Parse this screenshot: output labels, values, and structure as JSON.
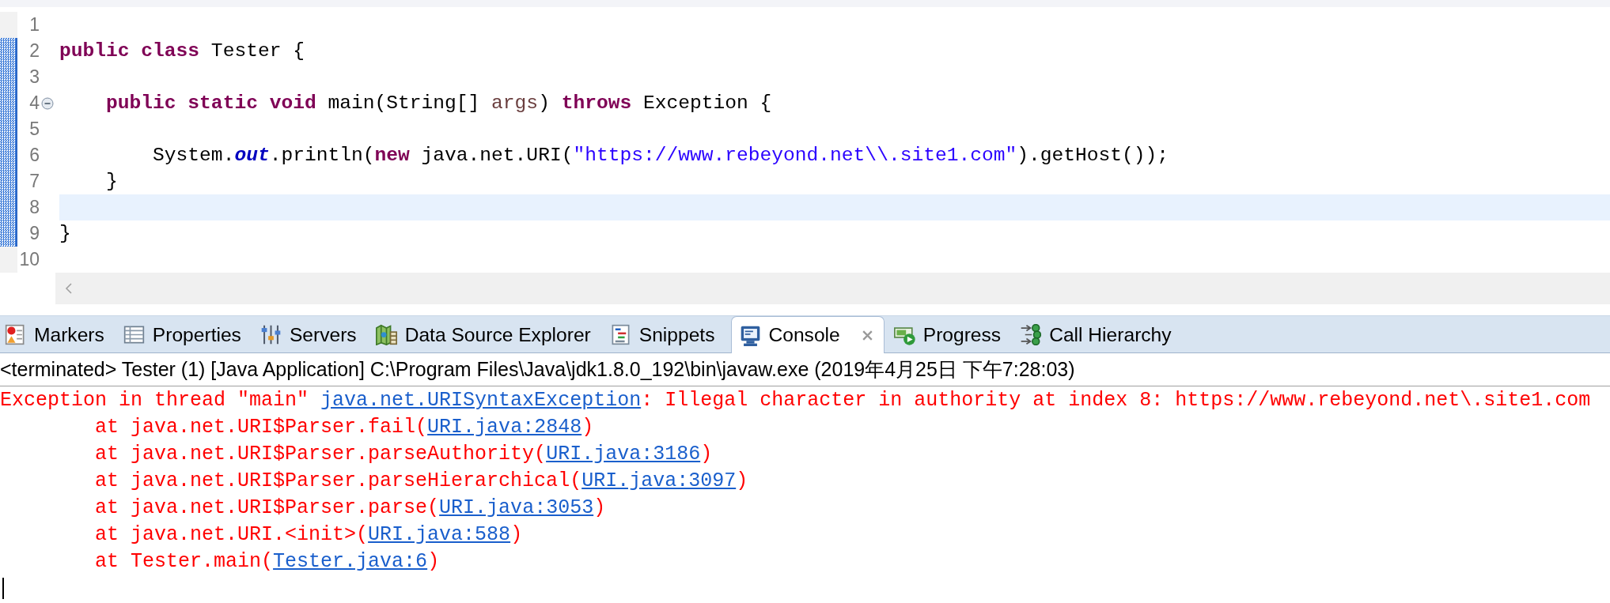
{
  "editor": {
    "lines": [
      {
        "number": "1",
        "changed": false,
        "current": false
      },
      {
        "number": "2",
        "changed": true,
        "current": false,
        "tokens": [
          {
            "text": "public class",
            "kind": "keyword"
          },
          {
            "text": " Tester {",
            "kind": "plain"
          }
        ]
      },
      {
        "number": "3",
        "changed": true,
        "current": false
      },
      {
        "number": "4",
        "changed": true,
        "current": false,
        "expanded": true,
        "tokens": [
          {
            "text": "\tpublic static void",
            "kind": "keyword"
          },
          {
            "text": " main(String[] ",
            "kind": "plain"
          },
          {
            "text": "args",
            "kind": "param"
          },
          {
            "text": ") ",
            "kind": "plain"
          },
          {
            "text": "throws",
            "kind": "keyword"
          },
          {
            "text": " Exception {",
            "kind": "plain"
          }
        ]
      },
      {
        "number": "5",
        "changed": true,
        "current": false
      },
      {
        "number": "6",
        "changed": true,
        "current": false,
        "tokens": [
          {
            "text": "\t\tSystem.",
            "kind": "plain"
          },
          {
            "text": "out",
            "kind": "field"
          },
          {
            "text": ".println(",
            "kind": "plain"
          },
          {
            "text": "new",
            "kind": "keyword"
          },
          {
            "text": " java.net.URI(",
            "kind": "plain"
          },
          {
            "text": "\"https://www.rebeyond.net\\\\.site1.com\"",
            "kind": "string"
          },
          {
            "text": ").getHost());",
            "kind": "plain"
          }
        ]
      },
      {
        "number": "7",
        "changed": true,
        "current": false,
        "tokens": [
          {
            "text": "\t}",
            "kind": "plain"
          }
        ]
      },
      {
        "number": "8",
        "changed": true,
        "current": true
      },
      {
        "number": "9",
        "changed": true,
        "current": false,
        "tokens": [
          {
            "text": "}",
            "kind": "plain"
          }
        ]
      },
      {
        "number": "10",
        "changed": false,
        "current": false
      }
    ]
  },
  "view_tabs": [
    {
      "label": "Markers",
      "kind": "markers",
      "selected": false
    },
    {
      "label": "Properties",
      "kind": "properties",
      "selected": false
    },
    {
      "label": "Servers",
      "kind": "servers",
      "selected": false
    },
    {
      "label": "Data Source Explorer",
      "kind": "data-source-explorer",
      "selected": false
    },
    {
      "label": "Snippets",
      "kind": "snippets",
      "selected": false
    },
    {
      "label": "Console",
      "kind": "console",
      "selected": true
    },
    {
      "label": "Progress",
      "kind": "progress",
      "selected": false
    },
    {
      "label": "Call Hierarchy",
      "kind": "call-hierarchy",
      "selected": false
    }
  ],
  "console": {
    "status": "<terminated> Tester (1) [Java Application] C:\\Program Files\\Java\\jdk1.8.0_192\\bin\\javaw.exe (2019年4月25日 下午7:28:03)",
    "lines": [
      {
        "segments": [
          {
            "text": "Exception in thread \"main\" ",
            "kind": "error"
          },
          {
            "text": "java.net.URISyntaxException",
            "kind": "link"
          },
          {
            "text": ": Illegal character in authority at index 8: https://www.rebeyond.net\\.site1.com",
            "kind": "error"
          }
        ]
      },
      {
        "segments": [
          {
            "text": "\tat java.net.URI$Parser.fail(",
            "kind": "error"
          },
          {
            "text": "URI.java:2848",
            "kind": "link"
          },
          {
            "text": ")",
            "kind": "error"
          }
        ]
      },
      {
        "segments": [
          {
            "text": "\tat java.net.URI$Parser.parseAuthority(",
            "kind": "error"
          },
          {
            "text": "URI.java:3186",
            "kind": "link"
          },
          {
            "text": ")",
            "kind": "error"
          }
        ]
      },
      {
        "segments": [
          {
            "text": "\tat java.net.URI$Parser.parseHierarchical(",
            "kind": "error"
          },
          {
            "text": "URI.java:3097",
            "kind": "link"
          },
          {
            "text": ")",
            "kind": "error"
          }
        ]
      },
      {
        "segments": [
          {
            "text": "\tat java.net.URI$Parser.parse(",
            "kind": "error"
          },
          {
            "text": "URI.java:3053",
            "kind": "link"
          },
          {
            "text": ")",
            "kind": "error"
          }
        ]
      },
      {
        "segments": [
          {
            "text": "\tat java.net.URI.<init>(",
            "kind": "error"
          },
          {
            "text": "URI.java:588",
            "kind": "link"
          },
          {
            "text": ")",
            "kind": "error"
          }
        ]
      },
      {
        "segments": [
          {
            "text": "\tat Tester.main(",
            "kind": "error"
          },
          {
            "text": "Tester.java:6",
            "kind": "link"
          },
          {
            "text": ")",
            "kind": "error"
          }
        ]
      }
    ]
  }
}
